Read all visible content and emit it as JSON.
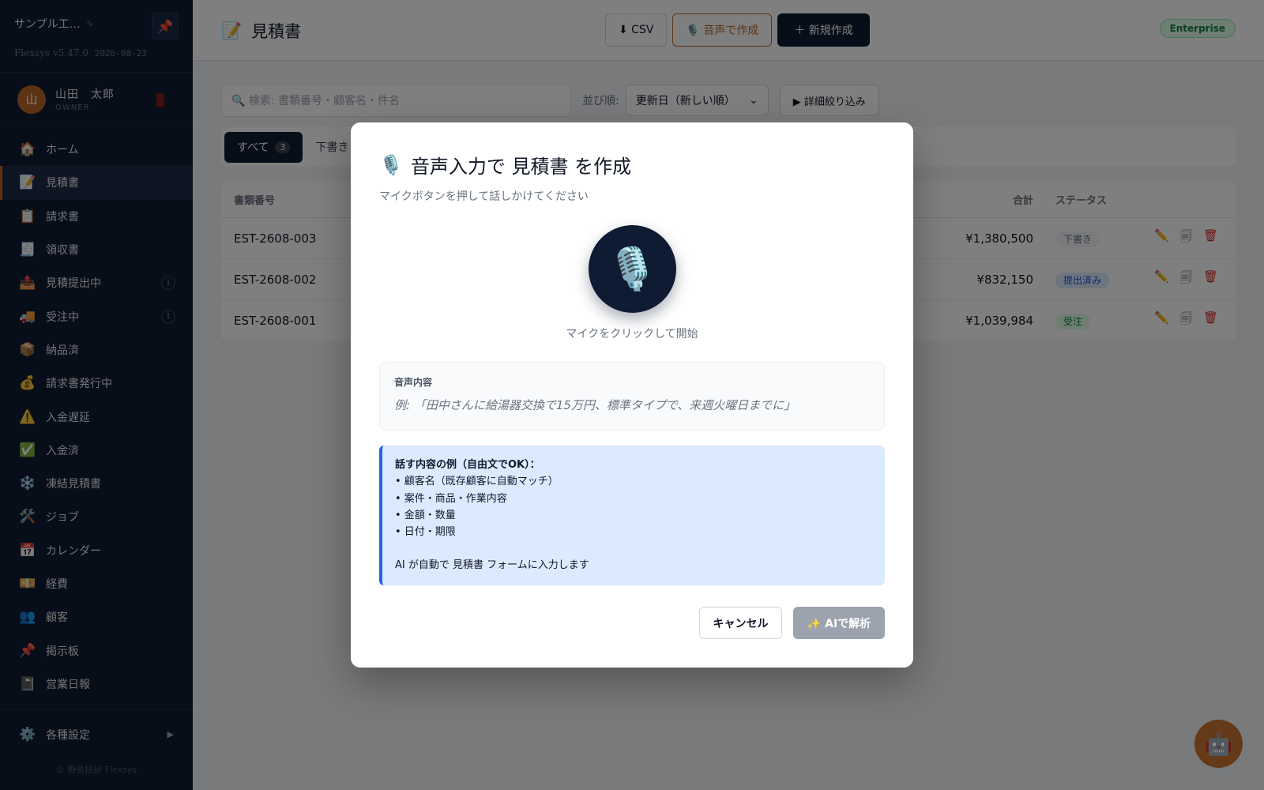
{
  "sidebar": {
    "company": "サンプル工…",
    "edit_icon": "✎",
    "pin_icon": "📌",
    "version": "Flexsys v5.47.0",
    "version_date": "2026-08-23",
    "user": {
      "initial": "山",
      "name": "山田　太郎",
      "role": "OWNER"
    },
    "items": [
      {
        "icon": "🏠",
        "label": "ホーム"
      },
      {
        "icon": "📝",
        "label": "見積書",
        "active": true
      },
      {
        "icon": "📋",
        "label": "請求書"
      },
      {
        "icon": "🧾",
        "label": "領収書"
      },
      {
        "icon": "📤",
        "label": "見積提出中",
        "count": "1"
      },
      {
        "icon": "🚚",
        "label": "受注中",
        "count": "1"
      },
      {
        "icon": "📦",
        "label": "納品済"
      },
      {
        "icon": "💰",
        "label": "請求書発行中"
      },
      {
        "icon": "⚠️",
        "label": "入金遅延"
      },
      {
        "icon": "✅",
        "label": "入金済"
      },
      {
        "icon": "❄️",
        "label": "凍結見積書"
      },
      {
        "icon": "🛠️",
        "label": "ジョブ"
      },
      {
        "icon": "📅",
        "label": "カレンダー"
      },
      {
        "icon": "💴",
        "label": "経費"
      },
      {
        "icon": "👥",
        "label": "顧客"
      },
      {
        "icon": "📌",
        "label": "掲示板"
      },
      {
        "icon": "📓",
        "label": "営業日報"
      }
    ],
    "settings": {
      "icon": "⚙️",
      "label": "各種設定",
      "arrow": "▶"
    },
    "footer": "© 野島技研 Flexsys"
  },
  "header": {
    "title_icon": "📝",
    "title": "見積書",
    "csv_label": "⬇ CSV",
    "voice_label": "🎙️ 音声で作成",
    "new_label": "＋ 新規作成",
    "plan": "Enterprise"
  },
  "toolbar": {
    "search_placeholder": "🔍 検索: 書類番号・顧客名・件名",
    "sort_label": "並び順:",
    "sort_value": "更新日（新しい順）",
    "filter_label": "▶ 詳細絞り込み"
  },
  "tabs": [
    {
      "label": "すべて",
      "count": "3",
      "active": true
    },
    {
      "label": "下書き"
    }
  ],
  "table": {
    "headers": {
      "num": "書類番号",
      "total": "合計",
      "status": "ステータス"
    },
    "rows": [
      {
        "num": "EST-2608-003",
        "total": "¥1,380,500",
        "status": "下書き",
        "status_bg": "#f3f4f6",
        "status_fg": "#6b7280"
      },
      {
        "num": "EST-2608-002",
        "total": "¥832,150",
        "status": "提出済み",
        "status_bg": "#dbeafe",
        "status_fg": "#1d4ed8"
      },
      {
        "num": "EST-2608-001",
        "total": "¥1,039,984",
        "status": "受注",
        "status_bg": "#dcfce7",
        "status_fg": "#15803d"
      }
    ],
    "action_icons": {
      "edit": "✏️",
      "copy": "🗐",
      "delete": "🗑"
    }
  },
  "modal": {
    "title_icon": "🎙️",
    "title": "音声入力で 見積書 を作成",
    "subtitle": "マイクボタンを押して話しかけてください",
    "mic_icon": "🎙️",
    "mic_caption": "マイクをクリックして開始",
    "transcript_label": "音声内容",
    "transcript_placeholder": "例: 「田中さんに給湯器交換で15万円、標準タイプで、来週火曜日までに」",
    "hint_title": "話す内容の例（自由文でOK）：",
    "hint_items": [
      "• 顧客名（既存顧客に自動マッチ）",
      "• 案件・商品・作業内容",
      "• 金額・数量",
      "• 日付・期限"
    ],
    "hint_footer": "AI が自動で 見積書 フォームに入力します",
    "cancel_label": "キャンセル",
    "ai_label": "✨ AIで解析"
  },
  "fab": {
    "icon": "🤖"
  },
  "colors": {
    "sidebar_bg": "#0f1b33",
    "accent": "#b8692b",
    "hint_bg": "#dbeafe",
    "hint_border": "#2563eb"
  }
}
